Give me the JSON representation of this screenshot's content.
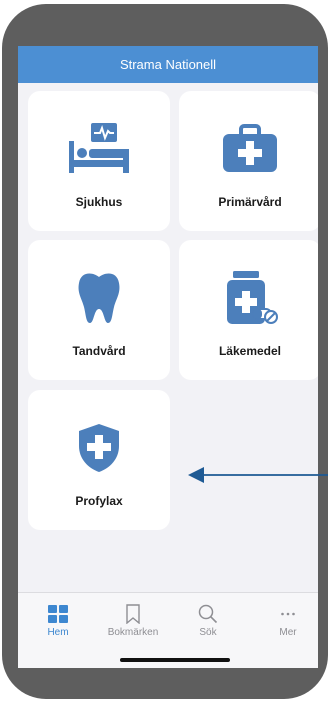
{
  "header": {
    "title": "Strama Nationell"
  },
  "tiles": [
    {
      "label": "Sjukhus",
      "icon": "hospital-bed-icon"
    },
    {
      "label": "Primärvård",
      "icon": "medical-kit-icon"
    },
    {
      "label": "Tandvård",
      "icon": "tooth-icon"
    },
    {
      "label": "Läkemedel",
      "icon": "medicine-bottle-icon"
    },
    {
      "label": "Profylax",
      "icon": "shield-cross-icon"
    }
  ],
  "tabbar": {
    "items": [
      {
        "label": "Hem",
        "icon": "grid-icon",
        "active": true
      },
      {
        "label": "Bokmärken",
        "icon": "bookmark-icon",
        "active": false
      },
      {
        "label": "Sök",
        "icon": "search-icon",
        "active": false
      },
      {
        "label": "Mer",
        "icon": "more-icon",
        "active": false
      }
    ]
  },
  "colors": {
    "header": "#4c8fd3",
    "icon": "#4c7fbb",
    "active_tab": "#3d87d0",
    "arrow": "#1e5a94"
  }
}
